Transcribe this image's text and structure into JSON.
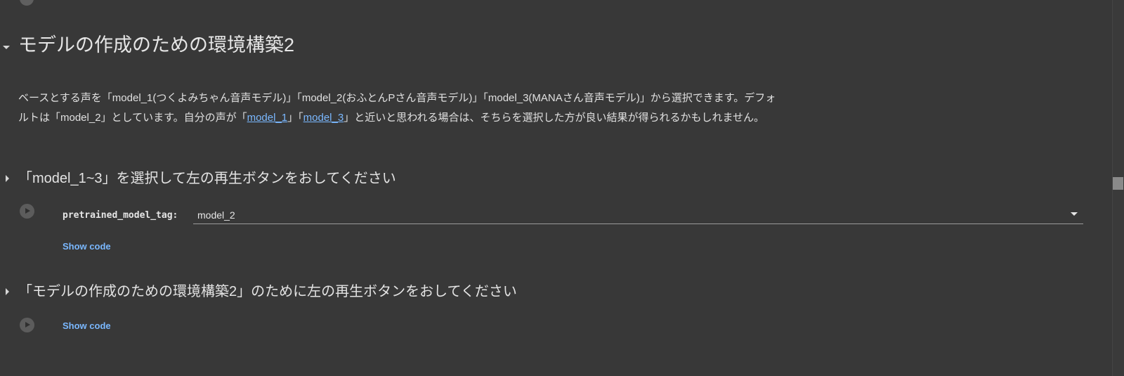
{
  "section_main": {
    "title": "モデルの作成のための環境構築2",
    "paragraph": {
      "part1": "ベースとする声を「model_1(つくよみちゃん音声モデル)」「model_2(おふとんPさん音声モデル)」「model_3(MANAさん音声モデル)」から選択できます。デフォルトは「model_2」としています。自分の声が「",
      "link1": "model_1",
      "part2": "」「",
      "link2": "model_3",
      "part3": "」と近いと思われる場合は、そちらを選択した方が良い結果が得られるかもしれません。"
    }
  },
  "subsection1": {
    "title": "「model_1~3」を選択して左の再生ボタンをおしてください",
    "form": {
      "label": "pretrained_model_tag:",
      "selected_value": "model_2"
    },
    "show_code_label": "Show code"
  },
  "subsection2": {
    "title": "「モデルの作成のための環境構築2」のために左の再生ボタンをおしてください",
    "show_code_label": "Show code"
  },
  "icons": {
    "collapse": "chevron-down-icon",
    "expand": "chevron-right-icon",
    "run": "play-circle-icon",
    "dropdown": "caret-down-icon"
  },
  "colors": {
    "background": "#383838",
    "link": "#7ab8ff",
    "text": "#e3e3e3"
  }
}
